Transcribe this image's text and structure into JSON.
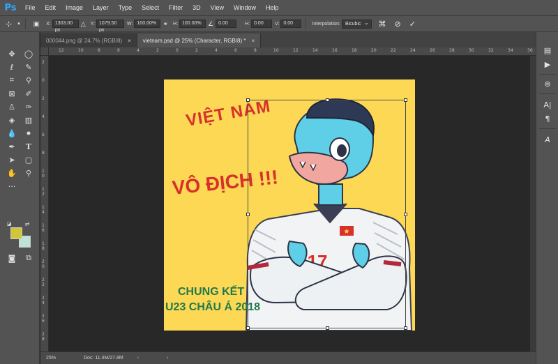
{
  "app": {
    "logo": "Ps"
  },
  "menu": [
    "File",
    "Edit",
    "Image",
    "Layer",
    "Type",
    "Select",
    "Filter",
    "3D",
    "View",
    "Window",
    "Help"
  ],
  "options": {
    "x_label": "X:",
    "x_value": "1303.00 px",
    "y_label": "Y:",
    "y_value": "1079.50 px",
    "w_label": "W:",
    "w_value": "100.00%",
    "h_label": "H:",
    "h_value": "100.00%",
    "angle_value": "0.00",
    "hskew_label": "H:",
    "hskew_value": "0.00",
    "vskew_label": "V:",
    "vskew_value": "0.00",
    "interpolation_label": "Interpolation:",
    "interpolation_value": "Bicubic"
  },
  "tabs": [
    {
      "label": "000044.png @ 24.7% (RGB/8)",
      "close": "×"
    },
    {
      "label": "vietnam.psd @ 25% (Character, RGB/8) *",
      "close": "×"
    }
  ],
  "ruler_h": [
    "12",
    "10",
    "8",
    "6",
    "4",
    "2",
    "0",
    "2",
    "4",
    "6",
    "8",
    "10",
    "12",
    "14",
    "16",
    "18",
    "20",
    "22",
    "24",
    "26",
    "28",
    "30",
    "32",
    "34",
    "36"
  ],
  "ruler_v": [
    "2",
    "0",
    "2",
    "4",
    "6",
    "8",
    "1 0",
    "1 2",
    "1 4",
    "1 6",
    "1 8",
    "2 0",
    "2 2",
    "2 4",
    "2 6",
    "2 8"
  ],
  "document": {
    "line1": "VIỆT NAM",
    "line2": "VÔ ĐỊCH !!!",
    "line3": "CHUNG KẾT",
    "line4": "U23 CHÂU Á 2018",
    "jersey_number": "17"
  },
  "colors": {
    "foreground": "#cfc63a",
    "background": "#bfe3d8",
    "canvas": "#fcd855"
  },
  "status": {
    "zoom": "25%",
    "doc": "Doc: 11.4M/27.8M",
    "arrow": "›",
    "nav": "‹"
  },
  "toolbar_icons": [
    "move-icon",
    "marquee-icon",
    "lasso-icon",
    "quick-select-icon",
    "crop-icon",
    "eyedropper-icon",
    "frame-icon",
    "brush-icon",
    "stamp-icon",
    "history-brush-icon",
    "eraser-icon",
    "gradient-icon",
    "blur-icon",
    "dodge-icon",
    "pen-icon",
    "type-icon",
    "path-select-icon",
    "shape-icon",
    "hand-icon",
    "zoom-icon",
    "more-tools-icon"
  ]
}
